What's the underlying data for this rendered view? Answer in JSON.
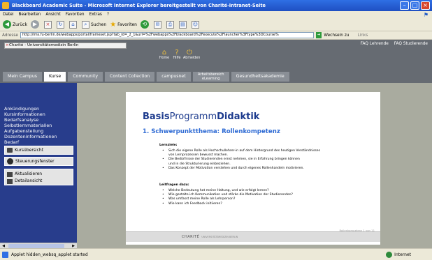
{
  "window": {
    "title": "Blackboard Academic Suite - Microsoft Internet Explorer bereitgestellt von Charité-Intranet-Seite"
  },
  "menubar": {
    "items": [
      "Datei",
      "Bearbeiten",
      "Ansicht",
      "Favoriten",
      "Extras",
      "?"
    ]
  },
  "toolbar": {
    "back_label": "Zurück",
    "search_label": "Suchen",
    "favorites_label": "Favoriten"
  },
  "address": {
    "label": "Adresse",
    "url": "http://lms.fu-berlin.de/webapps/portal/frameset.jsp?tab_id=_2_1&url=%2Fwebapps%2Fblackboard%2Fexecute%2Flauncher%3Ftype%3DCourse%",
    "go_label": "Wechseln zu",
    "links_label": "Links"
  },
  "bb_header": {
    "site_selector": "Charité - Universitätsmedizin Berlin",
    "top_links": [
      "FAQ Lehrende",
      "FAQ Studierende"
    ],
    "nav_icons": [
      {
        "label": "Home",
        "icon": "home-icon"
      },
      {
        "label": "Hilfe",
        "icon": "help-icon"
      },
      {
        "label": "Abmelden",
        "icon": "logout-icon"
      }
    ],
    "tabs": [
      {
        "label": "Mein Campus",
        "active": false
      },
      {
        "label": "Kurse",
        "active": true
      },
      {
        "label": "Community",
        "active": false
      },
      {
        "label": "Content Collection",
        "active": false
      },
      {
        "label": "campusnet",
        "active": false
      },
      {
        "label": "Arbeitsbereich eLearning",
        "active": false
      },
      {
        "label": "Gesundheitsakademie",
        "active": false
      }
    ]
  },
  "sidebar": {
    "links": [
      "Ankündigungen",
      "Kursinformationen",
      "Bedarfsanalyse",
      "Selbstlernmaterialien",
      "Aufgabenstellung",
      "Dozenteninformationen",
      "Bedarf"
    ],
    "buttons": {
      "course_overview": "Kursübersicht",
      "control_panel": "Steuerungsfenster"
    },
    "actions": {
      "refresh": "Aktualisieren",
      "detail_view": "Detailansicht"
    }
  },
  "slide": {
    "title_parts": [
      "Basis",
      "Programm",
      "Didaktik"
    ],
    "subtitle": "1. Schwerpunktthema:  Rollenkompetenz",
    "learning_goals_head": "Lernziele:",
    "learning_goals": [
      "Sich die eigene Rolle als Hochschullehrer-in auf dem Hintergrund des heutigen Verständnisses",
      "von Lernprozessen bewusst machen.",
      "Die Bedürfnisse der Studierenden ernst nehmen,  sie in Erfahrung bringen können",
      "und in die Strukturierung einbeziehen.",
      "Das Konzept der Motivation verstehen und durch eigenes Rollenhandeln motivieren."
    ],
    "guiding_questions_head": "Leitfragen dazu:",
    "guiding_questions": [
      "Welche Bedeutung hat meine Haltung, und wie erfolgt lernen?",
      "Wie gestalte ich Kommunikation und stärke die Motivation der Studierenden?",
      "Was umfasst meine Rolle als Lehrperson?",
      "Wie kann ich Feedback initiieren?"
    ],
    "page_number": "Rollenkompetenz  1  von 11",
    "footer_logo": "CHARITÉ",
    "footer_logo_sub": "UNIVERSITÄTSMEDIZIN BERLIN"
  },
  "statusbar": {
    "message": "Applet hidden_websq_applet started",
    "zone": "Internet"
  }
}
